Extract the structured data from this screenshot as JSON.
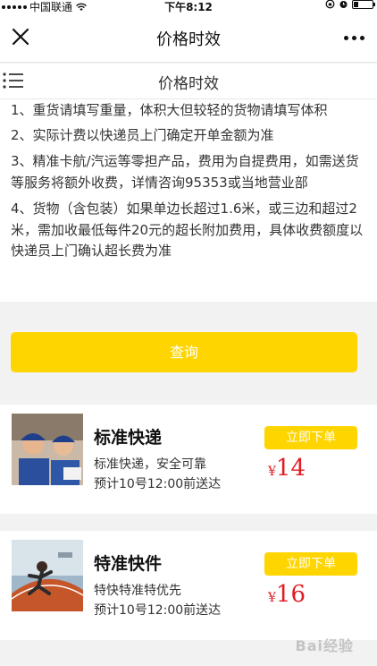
{
  "status_bar": {
    "carrier": "中国联通",
    "time": "下午8:12"
  },
  "nav": {
    "title": "价格时效"
  },
  "sub_header": {
    "title": "价格时效"
  },
  "notes": [
    "1、重货请填写重量，体积大但较轻的货物请填写体积",
    "2、实际计费以快递员上门确定开单金额为准",
    "3、精准卡航/汽运等零担产品，费用为自提费用，如需送货等服务将额外收费，详情咨询95353或当地营业部",
    "4、货物（含包装）如果单边长超过1.6米，或三边和超过2米，需加收最低每件20元的超长附加费用，具体收费额度以快递员上门确认超长费为准"
  ],
  "query_button": "查询",
  "products": [
    {
      "name": "标准快递",
      "desc": "标准快递，安全可靠",
      "eta": "预计10号12:00前送达",
      "order_label": "立即下单",
      "currency": "¥",
      "price": "14"
    },
    {
      "name": "特准快件",
      "desc": "特快特准特优先",
      "eta": "预计10号12:00前送达",
      "order_label": "立即下单",
      "currency": "¥",
      "price": "16"
    }
  ],
  "watermark": "Bai经验",
  "colors": {
    "accent_yellow": "#ffd500",
    "price_red": "#e21a22"
  }
}
